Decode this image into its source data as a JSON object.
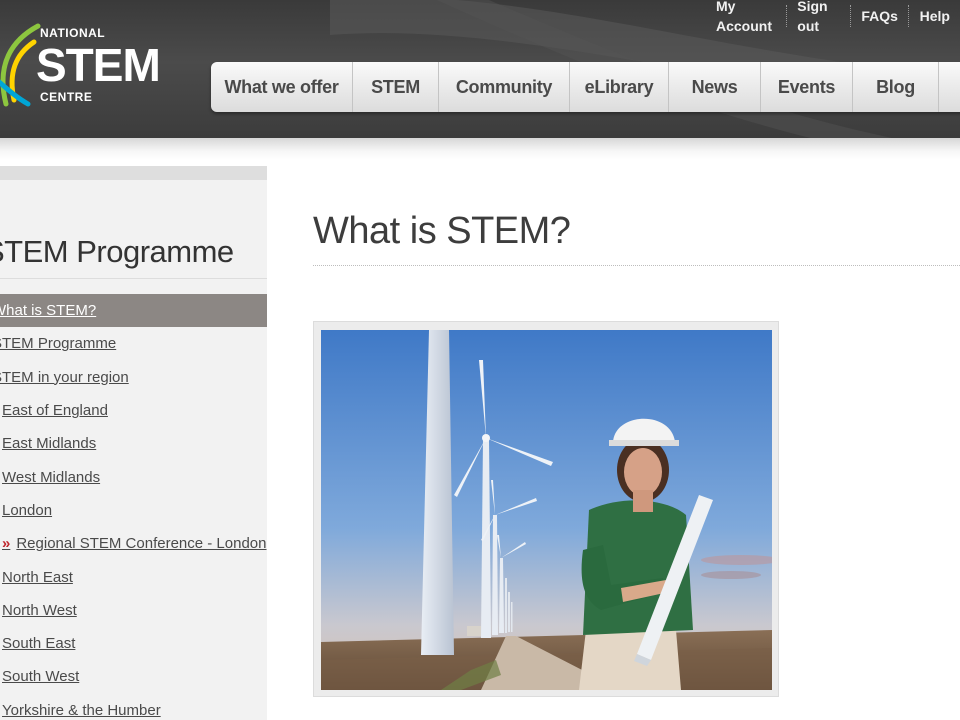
{
  "header": {
    "logo": {
      "line1": "NATIONAL",
      "line2": "STEM",
      "line3": "CENTRE"
    },
    "utility_links": [
      "My Account",
      "Sign out",
      "FAQs",
      "Help"
    ],
    "nav": [
      {
        "label": "What we offer"
      },
      {
        "label": "STEM"
      },
      {
        "label": "Community"
      },
      {
        "label": "eLibrary"
      },
      {
        "label": "News"
      },
      {
        "label": "Events"
      },
      {
        "label": "Blog"
      }
    ]
  },
  "sidebar": {
    "title": "STEM Programme",
    "items": [
      {
        "label": "What is STEM?",
        "active": true
      },
      {
        "label": "STEM Programme"
      },
      {
        "label": "STEM in your region"
      },
      {
        "label": "East of England"
      },
      {
        "label": "East Midlands"
      },
      {
        "label": "West Midlands"
      },
      {
        "label": "London"
      },
      {
        "label": "Regional STEM Conference - London",
        "marker": "»"
      },
      {
        "label": "North East"
      },
      {
        "label": "North West"
      },
      {
        "label": "South East"
      },
      {
        "label": "South West"
      },
      {
        "label": "Yorkshire & the Humber"
      }
    ]
  },
  "main": {
    "title": "What is STEM?",
    "image_icon": "photo-wind-turbines-engineer"
  },
  "colors": {
    "header_bg": "#444444",
    "active_item_bg": "#8c8784",
    "marker": "#c0272d",
    "logo_green": "#8dc63f",
    "logo_yellow": "#ffd400",
    "logo_blue": "#00a6d6"
  }
}
